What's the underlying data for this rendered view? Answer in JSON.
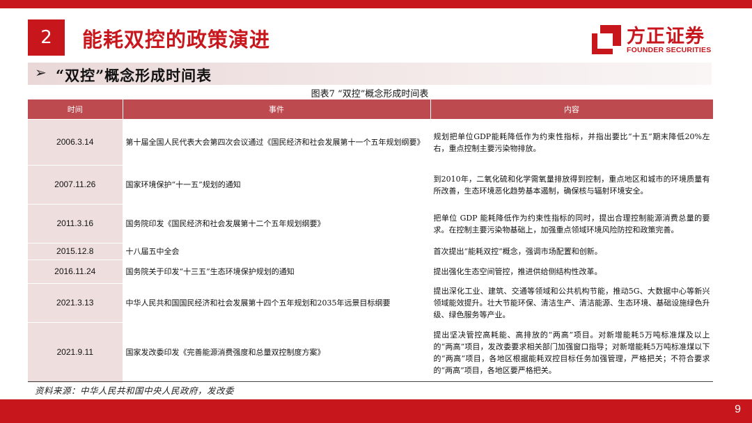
{
  "section_number": "2",
  "title": "能耗双控的政策演进",
  "logo": {
    "cn": "方正证券",
    "en": "FOUNDER SECURITIES"
  },
  "subheader": {
    "bullet": "➢",
    "text": "“双控”概念形成时间表"
  },
  "caption": "图表7 “双控”概念形成时间表",
  "table": {
    "headers": {
      "time": "时间",
      "event": "事件",
      "content": "内容"
    },
    "rows": [
      {
        "time": "2006.3.14",
        "event": "第十届全国人民代表大会第四次会议通过《国民经济和社会发展第十一个五年规划纲要》",
        "content": "规划把单位GDP能耗降低作为约束性指标，并指出要比“十五”期末降低20%左右，重点控制主要污染物排放。"
      },
      {
        "time": "2007.11.26",
        "event": "国家环境保护“十一五”规划的通知",
        "content": "到2010年，二氧化硫和化学需氧量排放得到控制，重点地区和城市的环境质量有所改善，生态环境恶化趋势基本遏制，确保核与辐射环境安全。"
      },
      {
        "time": "2011.3.16",
        "event": "国务院印发《国民经济和社会发展第十二个五年规划纲要》",
        "content": "把单位 GDP 能耗降低作为约束性指标的同时，提出合理控制能源消费总量的要求。在控制主要污染物基础上，加强重点领域环境风险防控和政策完善。"
      },
      {
        "time": "2015.12.8",
        "event": "十八届五中全会",
        "content": "首次提出“能耗双控”概念，强调市场配置和创新。"
      },
      {
        "time": "2016.11.24",
        "event": "国务院关于印发“十三五”生态环境保护规划的通知",
        "content": "提出强化生态空间管控，推进供给侧结构性改革。"
      },
      {
        "time": "2021.3.13",
        "event": "中华人民共和国国民经济和社会发展第十四个五年规划和2035年远景目标纲要",
        "content": "提出深化工业、建筑、交通等领域和公共机构节能，推动5G、大数据中心等新兴领域能效提升。壮大节能环保、清洁生产、清洁能源、生态环境、基础设施绿色升级、绿色服务等产业。"
      },
      {
        "time": "2021.9.11",
        "event": "国家发改委印发《完善能源消费强度和总量双控制度方案》",
        "content": "提出坚决管控高耗能、高排放的“两高”项目。对新增能耗5万吨标准煤及以上的“两高”项目，发改委要求相关部门加强窗口指导；对新增能耗5万吨标准煤以下的“两高”项目，各地区根据能耗双控目标任务加强管理，严格把关；不符合要求的“两高”项目，各地区要严格把关。"
      }
    ]
  },
  "source": "资料来源：中华人民共和国中央人民政府，发改委",
  "page_number": "9",
  "colors": {
    "brand_red": "#c8161d",
    "header_red": "#bd4a4f",
    "time_cell_bg": "#eedede"
  }
}
